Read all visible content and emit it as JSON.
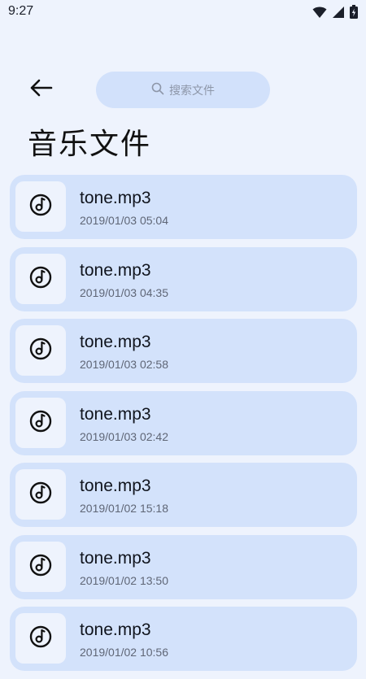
{
  "status_bar": {
    "time": "9:27"
  },
  "header": {
    "back_icon": "arrow-left-icon",
    "search": {
      "placeholder": "搜索文件",
      "icon": "search-icon"
    },
    "title": "音乐文件"
  },
  "file_list": {
    "items": [
      {
        "name": "tone.mp3",
        "date": "2019/01/03 05:04",
        "icon": "music-note-icon"
      },
      {
        "name": "tone.mp3",
        "date": "2019/01/03 04:35",
        "icon": "music-note-icon"
      },
      {
        "name": "tone.mp3",
        "date": "2019/01/03 02:58",
        "icon": "music-note-icon"
      },
      {
        "name": "tone.mp3",
        "date": "2019/01/03 02:42",
        "icon": "music-note-icon"
      },
      {
        "name": "tone.mp3",
        "date": "2019/01/02 15:18",
        "icon": "music-note-icon"
      },
      {
        "name": "tone.mp3",
        "date": "2019/01/02 13:50",
        "icon": "music-note-icon"
      },
      {
        "name": "tone.mp3",
        "date": "2019/01/02 10:56",
        "icon": "music-note-icon"
      }
    ]
  },
  "colors": {
    "background": "#eef3fd",
    "card": "#d3e2fb",
    "search_bg": "#d2e1fb"
  }
}
